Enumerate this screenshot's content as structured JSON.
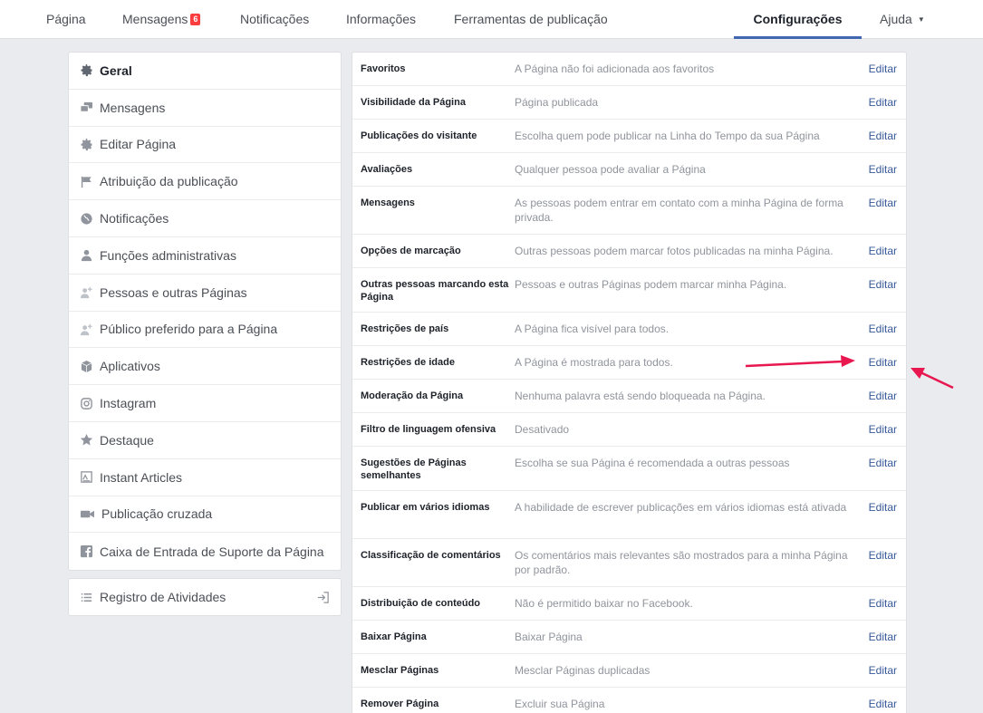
{
  "topnav": {
    "items": [
      {
        "label": "Página"
      },
      {
        "label": "Mensagens",
        "badge": "6"
      },
      {
        "label": "Notificações"
      },
      {
        "label": "Informações"
      },
      {
        "label": "Ferramentas de publicação"
      },
      {
        "label": "Configurações"
      },
      {
        "label": "Ajuda"
      }
    ],
    "active_color": "#4267b2",
    "badge_color": "#fa3e3e"
  },
  "sidebar": {
    "items": [
      {
        "label": "Geral",
        "icon": "gear-icon"
      },
      {
        "label": "Mensagens",
        "icon": "chat-bubbles-icon"
      },
      {
        "label": "Editar Página",
        "icon": "gear-icon"
      },
      {
        "label": "Atribuição da publicação",
        "icon": "flag-icon"
      },
      {
        "label": "Notificações",
        "icon": "globe-icon"
      },
      {
        "label": "Funções administrativas",
        "icon": "person-icon"
      },
      {
        "label": "Pessoas e outras Páginas",
        "icon": "person-plus-icon"
      },
      {
        "label": "Público preferido para a Página",
        "icon": "person-plus-icon"
      },
      {
        "label": "Aplicativos",
        "icon": "cube-icon"
      },
      {
        "label": "Instagram",
        "icon": "instagram-icon"
      },
      {
        "label": "Destaque",
        "icon": "star-icon"
      },
      {
        "label": "Instant Articles",
        "icon": "article-icon"
      },
      {
        "label": "Publicação cruzada",
        "icon": "video-camera-icon"
      },
      {
        "label": "Caixa de Entrada de Suporte da Página",
        "icon": "facebook-icon"
      }
    ],
    "activity": {
      "label": "Registro de Atividades",
      "icon": "list-icon"
    }
  },
  "settings": {
    "edit_label": "Editar",
    "rows": [
      {
        "label": "Favoritos",
        "value": "A Página não foi adicionada aos favoritos"
      },
      {
        "label": "Visibilidade da Página",
        "value": "Página publicada"
      },
      {
        "label": "Publicações do visitante",
        "value": "Escolha quem pode publicar na Linha do Tempo da sua Página"
      },
      {
        "label": "Avaliações",
        "value": "Qualquer pessoa pode avaliar a Página"
      },
      {
        "label": "Mensagens",
        "value": "As pessoas podem entrar em contato com a minha Página de forma privada."
      },
      {
        "label": "Opções de marcação",
        "value": "Outras pessoas podem marcar fotos publicadas na minha Página."
      },
      {
        "label": "Outras pessoas marcando esta Página",
        "value": "Pessoas e outras Páginas podem marcar minha Página."
      },
      {
        "label": "Restrições de país",
        "value": "A Página fica visível para todos."
      },
      {
        "label": "Restrições de idade",
        "value": "A Página é mostrada para todos."
      },
      {
        "label": "Moderação da Página",
        "value": "Nenhuma palavra está sendo bloqueada na Página."
      },
      {
        "label": "Filtro de linguagem ofensiva",
        "value": "Desativado"
      },
      {
        "label": "Sugestões de Páginas semelhantes",
        "value": "Escolha se sua Página é recomendada a outras pessoas"
      },
      {
        "label": "Publicar em vários idiomas",
        "value": "A habilidade de escrever publicações em vários idiomas está ativada"
      },
      {
        "label": "Classificação de comentários",
        "value": "Os comentários mais relevantes são mostrados para a minha Página por padrão."
      },
      {
        "label": "Distribuição de conteúdo",
        "value": "Não é permitido baixar no Facebook."
      },
      {
        "label": "Baixar Página",
        "value": "Baixar Página"
      },
      {
        "label": "Mesclar Páginas",
        "value": "Mesclar Páginas duplicadas"
      },
      {
        "label": "Remover Página",
        "value": "Excluir sua Página"
      }
    ]
  },
  "annotation": {
    "arrow_color": "#e8174f"
  }
}
